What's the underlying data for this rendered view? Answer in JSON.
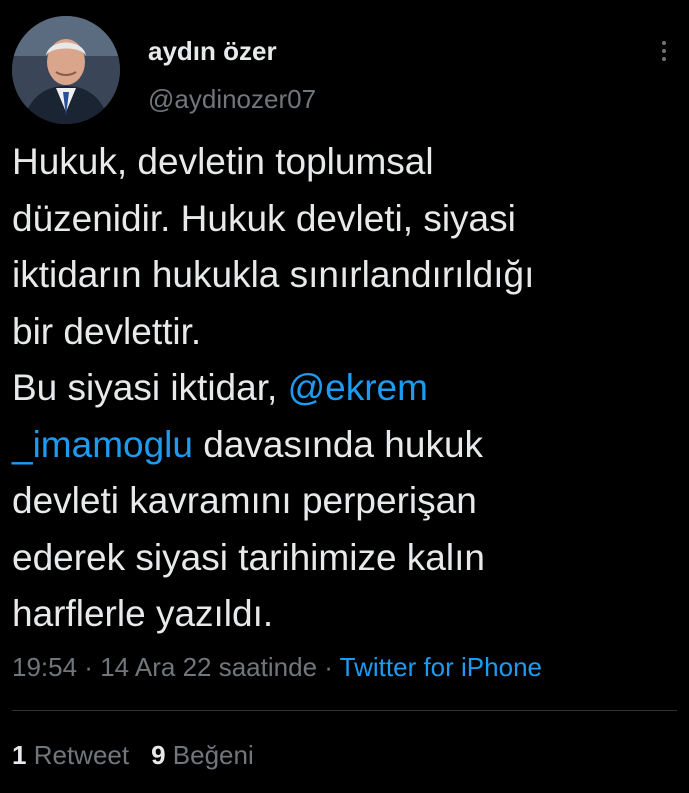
{
  "author": {
    "display_name": "aydın özer",
    "handle": "@aydinozer07"
  },
  "tweet": {
    "text_part1": "Hukuk, devletin toplumsal\ndüzenidir. Hukuk devleti, siyasi\niktidarın hukukla sınırlandırıldığı\nbir devlettir.\nBu siyasi iktidar, ",
    "mention": "@ekrem\n_imamoglu",
    "text_part2": " davasında hukuk\ndevleti kavramını perperişan\nederek siyasi tarihimize kalın\nharflerle yazıldı."
  },
  "meta": {
    "time": "19:54",
    "sep1": " · ",
    "date": "14 Ara 22 saatinde",
    "sep2": " · ",
    "source": "Twitter for iPhone"
  },
  "stats": {
    "retweet_count": "1",
    "retweet_label": "Retweet",
    "like_count": "9",
    "like_label": "Beğeni"
  },
  "colors": {
    "background": "#000000",
    "text": "#e7e9ea",
    "secondary": "#71767b",
    "accent": "#1d9bf0"
  },
  "icons": {
    "more": "more-dots-icon"
  }
}
